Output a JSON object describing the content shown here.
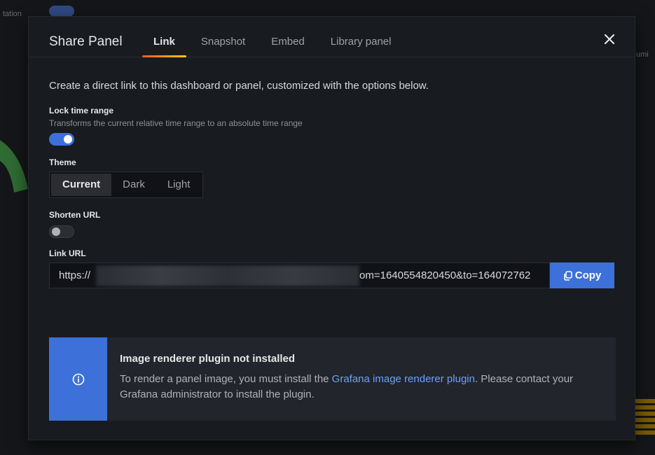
{
  "background": {
    "label_left": "tation",
    "label_right": "umi"
  },
  "modal": {
    "title": "Share Panel",
    "tabs": [
      {
        "label": "Link",
        "active": true
      },
      {
        "label": "Snapshot",
        "active": false
      },
      {
        "label": "Embed",
        "active": false
      },
      {
        "label": "Library panel",
        "active": false
      }
    ],
    "close_icon": "close-icon"
  },
  "link_tab": {
    "description": "Create a direct link to this dashboard or panel, customized with the options below.",
    "lock_time_range": {
      "label": "Lock time range",
      "description": "Transforms the current relative time range to an absolute time range",
      "enabled": true
    },
    "theme": {
      "label": "Theme",
      "options": [
        "Current",
        "Dark",
        "Light"
      ],
      "selected": "Current"
    },
    "shorten_url": {
      "label": "Shorten URL",
      "enabled": false
    },
    "link_url": {
      "label": "Link URL",
      "prefix": "https://",
      "suffix": "om=1640554820450&to=164072762",
      "copy_label": "Copy"
    }
  },
  "alert": {
    "icon": "info-icon",
    "title": "Image renderer plugin not installed",
    "text_before": "To render a panel image, you must install the ",
    "link_text": "Grafana image renderer plugin",
    "text_after": ". Please contact your Grafana administrator to install the plugin."
  },
  "colors": {
    "primary": "#3d71d9",
    "tab_underline_start": "#f05a28",
    "tab_underline_end": "#fbca0a",
    "link": "#6e9fff"
  }
}
